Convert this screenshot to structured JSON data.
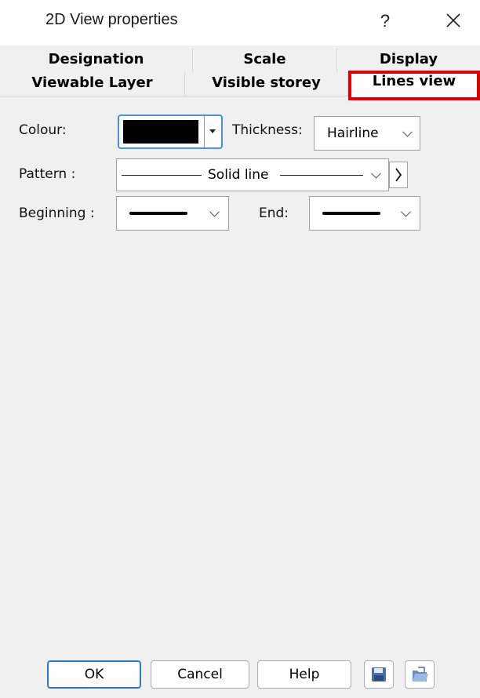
{
  "window": {
    "title": "2D View properties",
    "help": "?"
  },
  "tabs": {
    "row1": [
      "Designation",
      "Scale",
      "Display"
    ],
    "row2": [
      "Viewable Layer",
      "Visible storey",
      "Lines view"
    ],
    "active": "Lines view"
  },
  "form": {
    "colour_label": "Colour:",
    "colour_value": "#000000",
    "thickness_label": "Thickness:",
    "thickness_value": "Hairline",
    "pattern_label": "Pattern :",
    "pattern_value": "Solid line",
    "beginning_label": "Beginning :",
    "end_label": "End:"
  },
  "buttons": {
    "ok": "OK",
    "cancel": "Cancel",
    "help": "Help"
  },
  "icons": {
    "save": "save-icon",
    "open": "open-folder-icon"
  },
  "colors": {
    "highlight": "#e00000",
    "ok_border": "#2e7ad1"
  }
}
